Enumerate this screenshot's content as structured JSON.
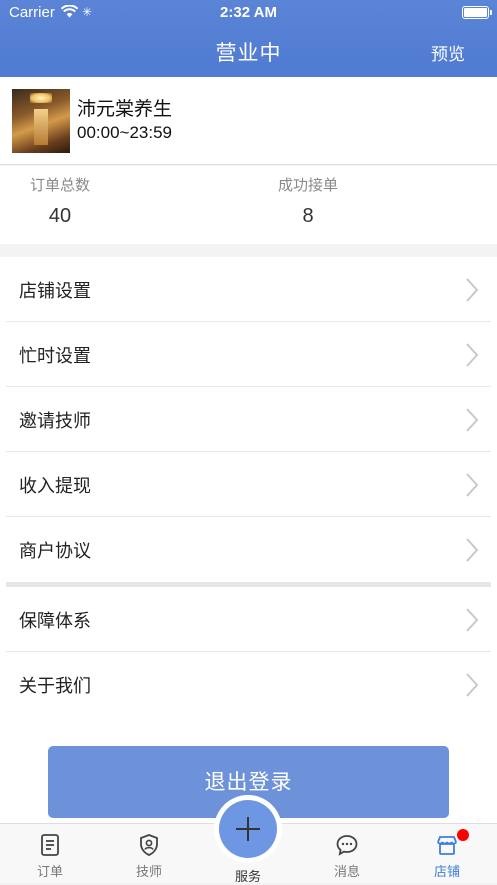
{
  "status_bar": {
    "carrier": "Carrier",
    "time": "2:32 AM"
  },
  "nav": {
    "title": "营业中",
    "preview": "预览"
  },
  "shop": {
    "name": "沛元棠养生",
    "hours": "00:00~23:59"
  },
  "stats": [
    {
      "label": "订单总数",
      "value": "40"
    },
    {
      "label": "成功接单",
      "value": "8"
    }
  ],
  "menu": {
    "group1": [
      {
        "label": "店铺设置"
      },
      {
        "label": "忙时设置"
      },
      {
        "label": "邀请技师"
      },
      {
        "label": "收入提现"
      },
      {
        "label": "商户协议"
      }
    ],
    "group2": [
      {
        "label": "保障体系"
      },
      {
        "label": "关于我们"
      }
    ]
  },
  "logout": {
    "label": "退出登录"
  },
  "tabbar": {
    "orders": "订单",
    "technicians": "技师",
    "service": "服务",
    "messages": "消息",
    "store": "店铺",
    "active_color": "#3f7fd8",
    "active": "store"
  },
  "colors": {
    "header": "#5b84d6",
    "button": "#6e92d9",
    "badge": "#ff0000"
  }
}
